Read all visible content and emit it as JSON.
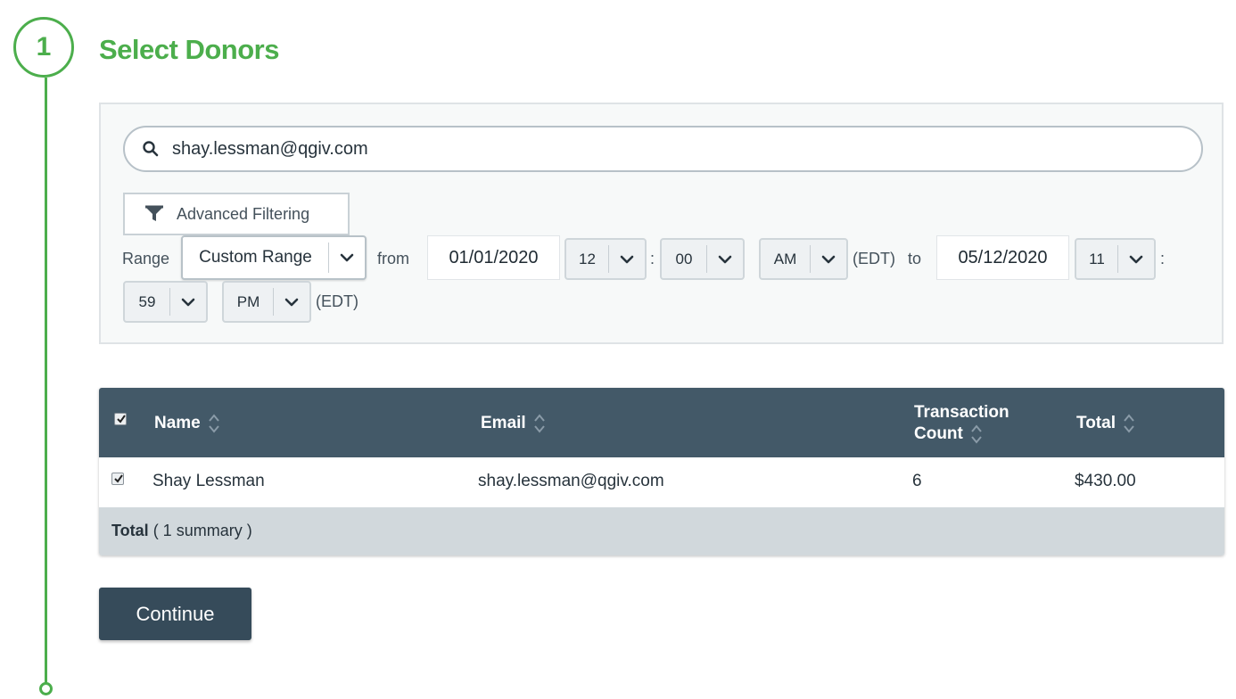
{
  "step": {
    "number": "1",
    "title": "Select Donors"
  },
  "search": {
    "value": "shay.lessman@qgiv.com",
    "icon": "search-icon"
  },
  "advanced_filter": {
    "label": "Advanced Filtering",
    "icon": "funnel-icon"
  },
  "range": {
    "label": "Range",
    "type_value": "Custom Range",
    "from_label": "from",
    "from_date": "01/01/2020",
    "from_hour": "12",
    "from_minute": "00",
    "from_ampm": "AM",
    "from_tz": "(EDT)",
    "to_label": "to",
    "to_date": "05/12/2020",
    "to_hour": "11",
    "to_minute": "59",
    "to_ampm": "PM",
    "to_tz": "(EDT)",
    "colon": ":"
  },
  "table": {
    "columns": [
      "Name",
      "Email",
      "Transaction",
      "Count",
      "Total"
    ],
    "rows": [
      {
        "checked": true,
        "name": "Shay Lessman",
        "email": "shay.lessman@qgiv.com",
        "count": "6",
        "total": "$430.00"
      }
    ],
    "footer_label": "Total",
    "footer_summary": "( 1 summary )"
  },
  "continue_label": "Continue",
  "colors": {
    "accent_green": "#4cae4c",
    "header_bg": "#435968",
    "button_bg": "#364b5a"
  }
}
